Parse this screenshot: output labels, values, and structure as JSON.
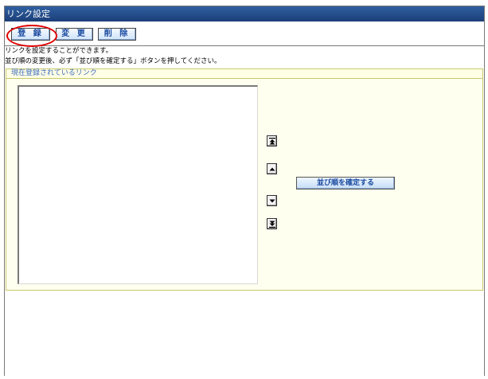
{
  "window": {
    "title": "リンク設定"
  },
  "toolbar": {
    "register_label": "登 録",
    "change_label": "変 更",
    "delete_label": "削 除"
  },
  "messages": {
    "line1": "リンクを設定することができます。",
    "line2": "並び順の変更後、必ず「並び順を確定する」ボタンを押してください。"
  },
  "panel": {
    "header": "現在登録されているリンク",
    "links": [],
    "confirm_label": "並び順を確定する"
  },
  "icons": {
    "move_top": "move-to-top-icon",
    "move_up": "move-up-icon",
    "move_down": "move-down-icon",
    "move_bottom": "move-to-bottom-icon"
  },
  "colors": {
    "title_bar": "#1c3f78",
    "button_text": "#1a4aa0",
    "panel_bg": "#fffff0",
    "panel_header_text": "#3a6bbf",
    "highlight_circle": "#e00000"
  }
}
